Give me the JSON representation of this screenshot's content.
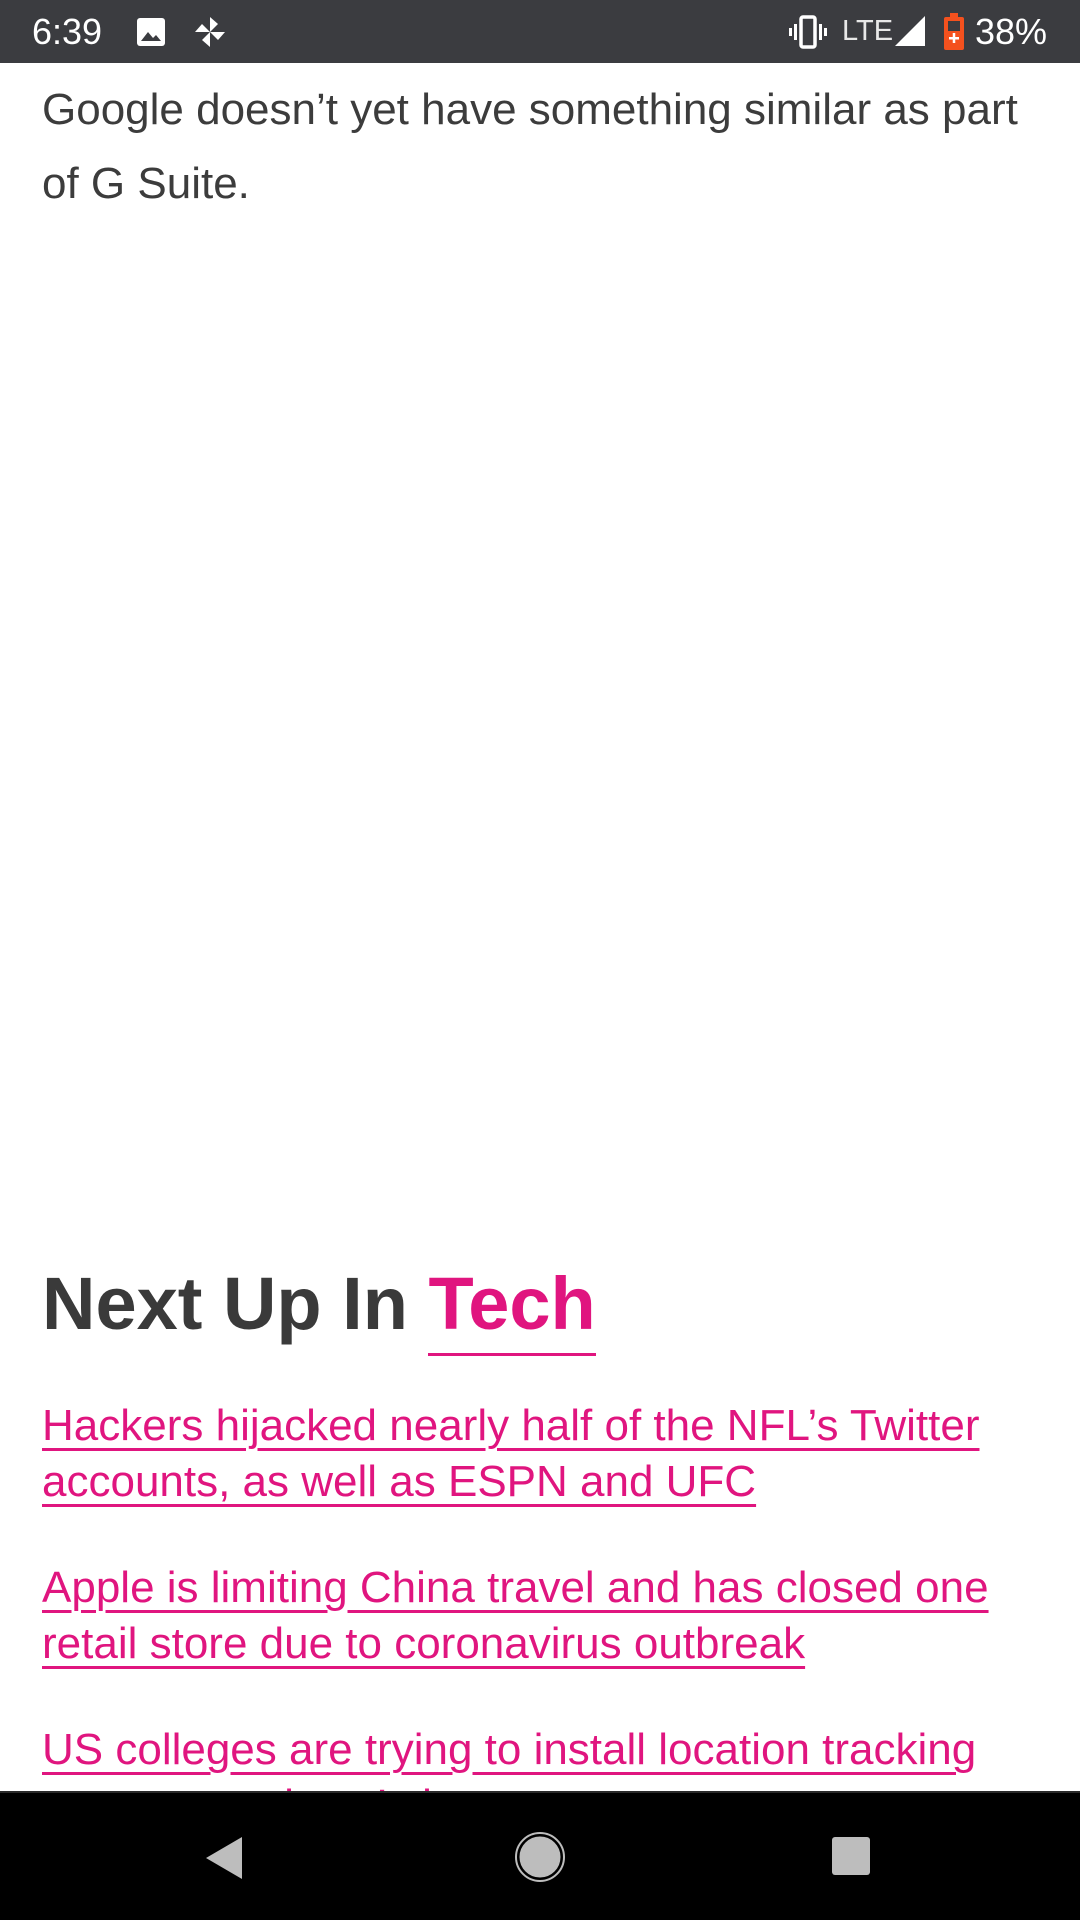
{
  "status_bar": {
    "time": "6:39",
    "network": "LTE",
    "battery": "38%",
    "icons": [
      "image-icon",
      "pinwheel-icon",
      "vibrate-icon",
      "signal-icon",
      "battery-charging-icon"
    ]
  },
  "article": {
    "paragraph_tail": "Google doesn’t yet have something similar as part of G Suite."
  },
  "next_up": {
    "prefix": "Next Up In",
    "category": "Tech",
    "headlines": [
      "Hackers hijacked nearly half of the NFL’s Twitter accounts, as well as ESPN and UFC",
      "Apple is limiting China travel and has closed one retail store due to coronavirus outbreak",
      "US colleges are trying to install location tracking apps on students’ phones"
    ]
  },
  "nav_bar": {
    "icons": [
      "back-icon",
      "home-icon",
      "recents-icon"
    ]
  },
  "colors": {
    "accent": "#e0157f",
    "status_bar_bg": "#3b3c40",
    "nav_bar_bg": "#000000",
    "body_text": "#3c3c3c",
    "battery_icon": "#f4511e"
  }
}
